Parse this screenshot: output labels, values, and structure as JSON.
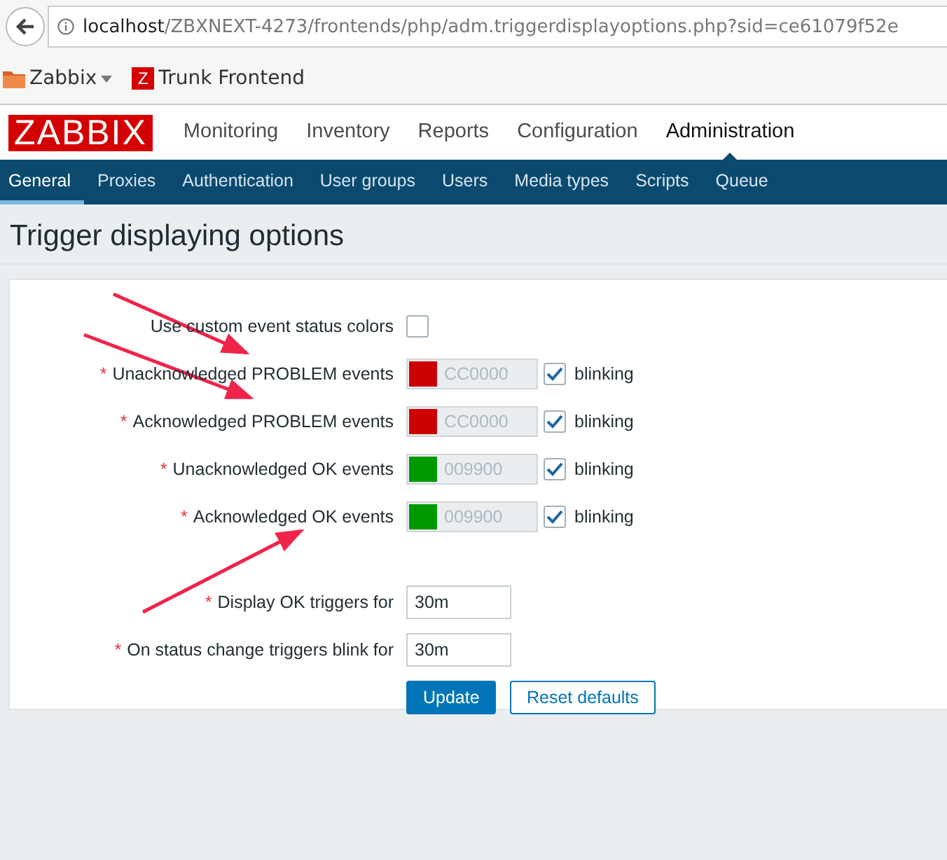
{
  "browser": {
    "url_host": "localhost",
    "url_path": "/ZBXNEXT-4273/frontends/php/adm.triggerdisplayoptions.php?sid=ce61079f52e",
    "bookmarks": [
      {
        "kind": "folder",
        "label": "Zabbix"
      },
      {
        "kind": "site",
        "icon_letter": "Z",
        "label": "Trunk Frontend"
      }
    ]
  },
  "header": {
    "logo": "ZABBIX",
    "menu": [
      {
        "label": "Monitoring",
        "selected": false
      },
      {
        "label": "Inventory",
        "selected": false
      },
      {
        "label": "Reports",
        "selected": false
      },
      {
        "label": "Configuration",
        "selected": false
      },
      {
        "label": "Administration",
        "selected": true
      }
    ]
  },
  "submenu": [
    {
      "label": "General",
      "selected": true
    },
    {
      "label": "Proxies",
      "selected": false
    },
    {
      "label": "Authentication",
      "selected": false
    },
    {
      "label": "User groups",
      "selected": false
    },
    {
      "label": "Users",
      "selected": false
    },
    {
      "label": "Media types",
      "selected": false
    },
    {
      "label": "Scripts",
      "selected": false
    },
    {
      "label": "Queue",
      "selected": false
    }
  ],
  "page_title": "Trigger displaying options",
  "form": {
    "custom_colors": {
      "label": "Use custom event status colors",
      "checked": false
    },
    "color_rows": [
      {
        "label": "Unacknowledged PROBLEM events",
        "required_mark": "*",
        "color": "#cc0000",
        "value": "CC0000",
        "blinking_label": "blinking",
        "blinking": true
      },
      {
        "label": "Acknowledged PROBLEM events",
        "required_mark": "*",
        "color": "#cc0000",
        "value": "CC0000",
        "blinking_label": "blinking",
        "blinking": true
      },
      {
        "label": "Unacknowledged OK events",
        "required_mark": "*",
        "color": "#009900",
        "value": "009900",
        "blinking_label": "blinking",
        "blinking": true
      },
      {
        "label": "Acknowledged OK events",
        "required_mark": "*",
        "color": "#009900",
        "value": "009900",
        "blinking_label": "blinking",
        "blinking": true
      }
    ],
    "time_rows": [
      {
        "label": "Display OK triggers for",
        "required_mark": "*",
        "value": "30m"
      },
      {
        "label": "On status change triggers blink for",
        "required_mark": "*",
        "value": "30m"
      }
    ],
    "buttons": [
      {
        "kind": "primary",
        "label": "Update"
      },
      {
        "kind": "secondary",
        "label": "Reset defaults"
      }
    ]
  }
}
